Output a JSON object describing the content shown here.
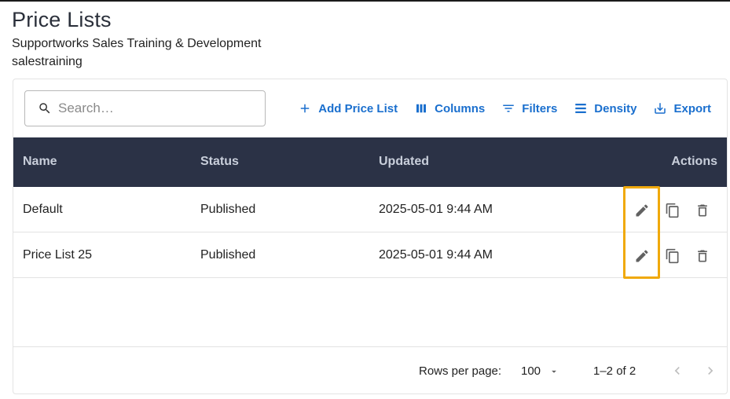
{
  "header": {
    "title": "Price Lists",
    "subtitle": "Supportworks Sales Training & Development",
    "account": "salestraining"
  },
  "search": {
    "placeholder": "Search…",
    "value": ""
  },
  "toolbar": {
    "add_label": "Add Price List",
    "columns_label": "Columns",
    "filters_label": "Filters",
    "density_label": "Density",
    "export_label": "Export"
  },
  "table": {
    "columns": [
      "Name",
      "Status",
      "Updated",
      "Actions"
    ],
    "rows": [
      {
        "name": "Default",
        "status": "Published",
        "updated": "2025-05-01 9:44 AM"
      },
      {
        "name": "Price List 25",
        "status": "Published",
        "updated": "2025-05-01 9:44 AM"
      }
    ]
  },
  "pagination": {
    "rows_per_page_label": "Rows per page:",
    "rows_per_page": "100",
    "range": "1–2 of 2"
  },
  "colors": {
    "accent": "#1a6fce",
    "header_bg": "#2b3246",
    "highlight": "#f0a90b"
  },
  "icons": [
    "search-icon",
    "plus-icon",
    "columns-icon",
    "filter-icon",
    "density-icon",
    "export-icon",
    "edit-icon",
    "copy-icon",
    "delete-icon",
    "chevron-down-icon",
    "chevron-left-icon",
    "chevron-right-icon"
  ]
}
